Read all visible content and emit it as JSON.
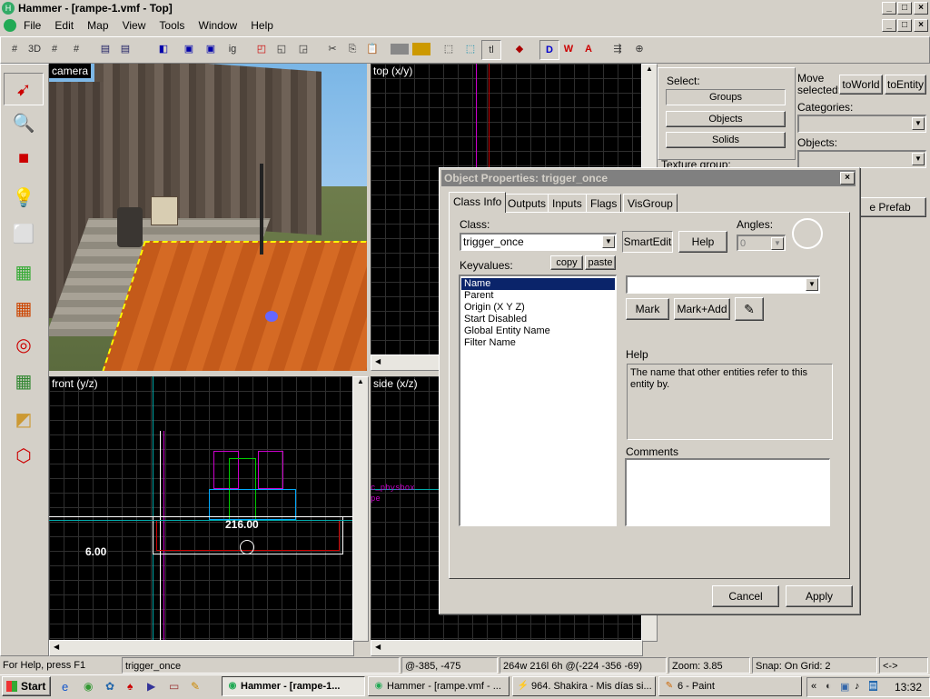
{
  "window": {
    "title": "Hammer - [rampe-1.vmf - Top]"
  },
  "menubar": {
    "items": [
      "File",
      "Edit",
      "Map",
      "View",
      "Tools",
      "Window",
      "Help"
    ]
  },
  "viewports": {
    "camera": "camera",
    "top": "top (x/y)",
    "front": "front (y/z)",
    "side": "side (x/z)",
    "front_dim_width": "216.00",
    "front_dim_height": "6.00",
    "side_label1": "c_physbox",
    "side_label2": "pe"
  },
  "right_panel": {
    "select_label": "Select:",
    "groups": "Groups",
    "objects": "Objects",
    "solids": "Solids",
    "move_selected": "Move selected:",
    "to_world": "toWorld",
    "to_entity": "toEntity",
    "categories": "Categories:",
    "objects_label": "Objects:",
    "texture_group": "Texture group:",
    "prefab_button": "e Prefab"
  },
  "dialog": {
    "title": "Object Properties: trigger_once",
    "tabs": [
      "Class Info",
      "Outputs",
      "Inputs",
      "Flags",
      "VisGroup"
    ],
    "class_label": "Class:",
    "class_value": "trigger_once",
    "smartedit": "SmartEdit",
    "help_button": "Help",
    "angles_label": "Angles:",
    "angles_value": "0",
    "keyvalues_label": "Keyvalues:",
    "copy": "copy",
    "paste": "paste",
    "keyvalues": [
      "Name",
      "Parent",
      "Origin (X Y Z)",
      "Start Disabled",
      "Global Entity Name",
      "Filter Name"
    ],
    "selected_index": 0,
    "mark": "Mark",
    "mark_add": "Mark+Add",
    "help_label": "Help",
    "help_text": "The name that other entities refer to this entity by.",
    "comments_label": "Comments",
    "cancel": "Cancel",
    "apply": "Apply"
  },
  "statusbar": {
    "help": "For Help, press F1",
    "selection": "trigger_once",
    "coords": "@-385, -475",
    "size": "264w 216l 6h @(-224 -356 -69)",
    "zoom": "Zoom: 3.85",
    "snap": "Snap: On Grid: 2",
    "arrows": "<->"
  },
  "taskbar": {
    "start": "Start",
    "tasks": [
      "Hammer - [rampe-1...",
      "Hammer - [rampe.vmf - ...",
      "964. Shakira - Mis días si...",
      "6 - Paint"
    ],
    "clock": "13:32"
  },
  "colors": {
    "selection": "#0a246a",
    "dialog_title_inactive": "#808080"
  }
}
